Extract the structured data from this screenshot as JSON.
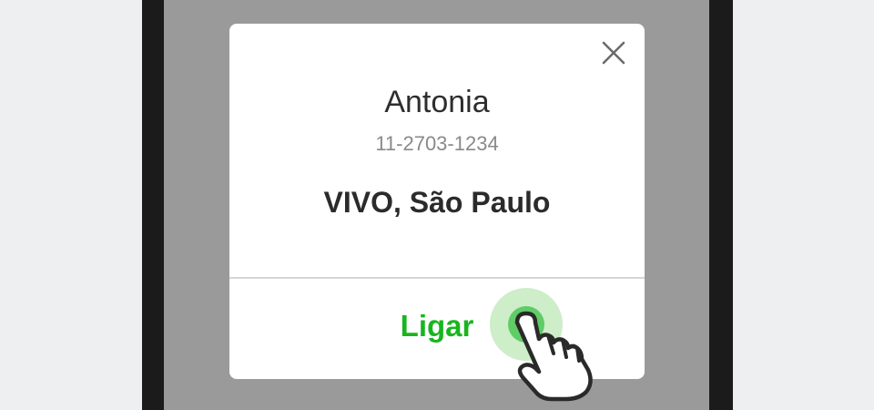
{
  "dialog": {
    "close_icon": "close-icon",
    "contact_name": "Antonia",
    "contact_phone": "11-2703-1234",
    "carrier_location": "VIVO, São Paulo",
    "call_label": "Ligar"
  },
  "tap_indicator": {
    "icon": "pointing-hand-icon"
  },
  "colors": {
    "accent_green": "#19b51e",
    "tap_green": "#5fcc66",
    "tap_halo": "#cdeec8",
    "overlay": "#9a9a9a",
    "frame": "#1b1b1b",
    "page_background": "#eeeff1"
  }
}
